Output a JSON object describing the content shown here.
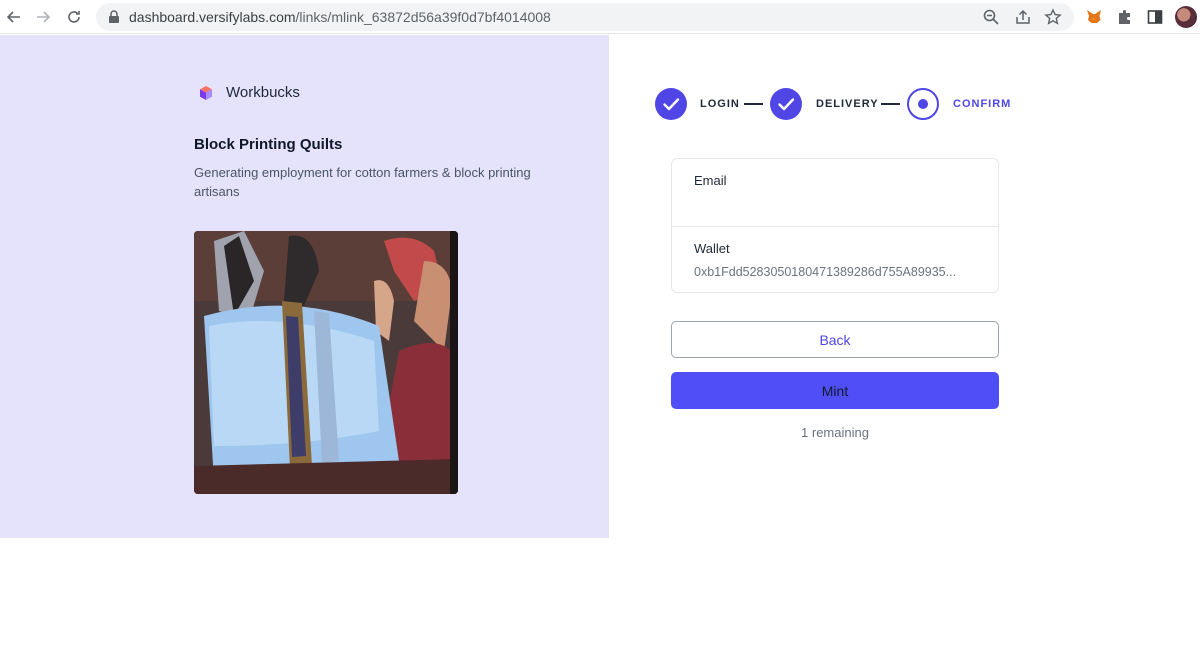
{
  "browser": {
    "url_host": "dashboard.versifylabs.com",
    "url_path": "/links/mlink_63872d56a39f0d7bf4014008",
    "icons": [
      "back-icon",
      "forward-icon",
      "reload-icon",
      "lock-icon",
      "zoom-icon",
      "share-icon",
      "bookmark-star-icon",
      "metamask-fox-icon",
      "extensions-puzzle-icon",
      "side-panel-icon",
      "profile-avatar"
    ]
  },
  "project": {
    "brand_name": "Workbucks",
    "title": "Block Printing Quilts",
    "description": "Generating employment for cotton farmers & block printing artisans"
  },
  "stepper": {
    "steps": [
      {
        "label": "LOGIN",
        "status": "done"
      },
      {
        "label": "DELIVERY",
        "status": "done"
      },
      {
        "label": "CONFIRM",
        "status": "current"
      }
    ]
  },
  "form": {
    "email_label": "Email",
    "email_value": "",
    "wallet_label": "Wallet",
    "wallet_value": "0xb1Fdd5283050180471389286d755A89935..."
  },
  "actions": {
    "back_label": "Back",
    "mint_label": "Mint",
    "remaining_text": "1 remaining"
  },
  "colors": {
    "accent": "#4f46e5",
    "mint_button": "#4f4ef7",
    "left_panel_bg": "#e5e3fc"
  }
}
